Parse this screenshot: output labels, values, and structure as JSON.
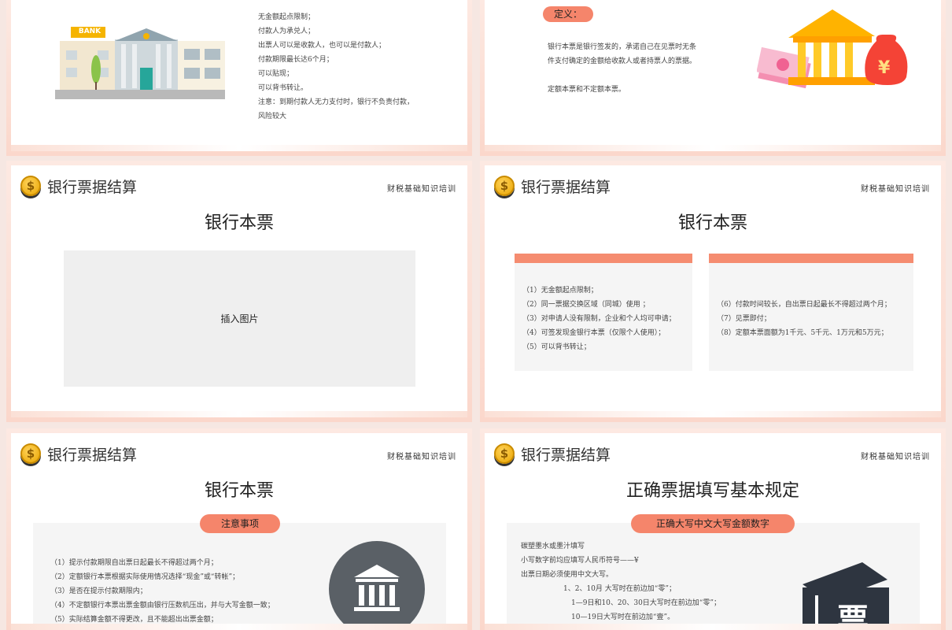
{
  "slide1": {
    "bank_sign": "BANK",
    "lines": [
      "无金额起点限制；",
      "付款人为承兑人；",
      "出票人可以是收款人，也可以是付款人；",
      "付款期限最长达6个月；",
      "可以贴现；",
      "可以背书转让。",
      "注意：到期付款人无力支付时，银行不负责付款，",
      "风险较大"
    ]
  },
  "slide2": {
    "tag": "定义：",
    "definition_lines": [
      "银行本票是银行签发的，承诺自己在见票时无条",
      "件支付确定的金额给收款人或者持票人的票据。"
    ],
    "note": "定额本票和不定额本票。",
    "yen_symbol": "¥"
  },
  "slide3": {
    "header": "银行票据结算",
    "right": "财税基础知识培训",
    "title": "银行本票",
    "placeholder": "插入图片"
  },
  "slide4": {
    "header": "银行票据结算",
    "right": "财税基础知识培训",
    "title": "银行本票",
    "left_items": [
      "（1）无金额起点限制；",
      "（2）同一票据交换区域（同城）使用 ；",
      "（3）对申请人没有限制，企业和个人均可申请；",
      "（4）可签发现金银行本票（仅限个人使用）；",
      "（5）可以背书转让；"
    ],
    "right_items": [
      "（6）付款时间较长，自出票日起最长不得超过两个月；",
      "（7）见票即付；",
      "（8）定额本票面额为1千元、5千元、1万元和5万元；"
    ]
  },
  "slide5": {
    "header": "银行票据结算",
    "right": "财税基础知识培训",
    "title": "银行本票",
    "pill": "注意事项",
    "items": [
      "（1）提示付款期限自出票日起最长不得超过两个月；",
      "（2）定额银行本票根据实际使用情况选择“现金”或“转帐”；",
      "（3）是否在提示付款期限内；",
      "（4）不定额银行本票出票金额由银行压数机压出，并与大写金额一致；",
      "（5）实际结算金额不得更改，且不能超出出票金额；"
    ]
  },
  "slide6": {
    "header": "银行票据结算",
    "right": "财税基础知识培训",
    "title": "正确票据填写基本规定",
    "pill": "正确大写中文大写金额数字",
    "lines": [
      "碳塑墨水或墨汁填写",
      "小写数字前均应填写人民币符号——¥",
      "出票日期必须使用中文大写。",
      "1、2、10月  大写时在前边加“零”；",
      "1—9日和10、20、30日大写时在前边加“零”；",
      "10—19日大写时在前边加“壹”。"
    ],
    "ticket_char": "票"
  },
  "coin_symbol": "$"
}
